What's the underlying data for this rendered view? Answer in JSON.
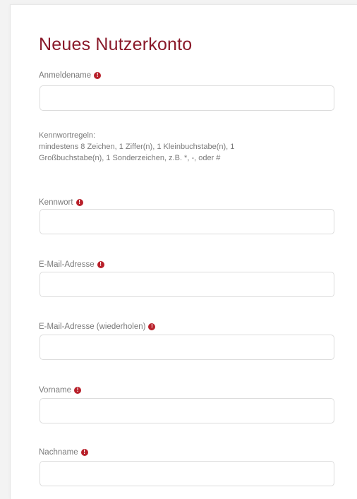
{
  "form": {
    "title": "Neues Nutzerkonto",
    "required_icon": "exclamation-circle-icon",
    "accent_color": "#8a1a2a",
    "required_color": "#b8202a",
    "fields": [
      {
        "label": "Anmeldename",
        "value": "",
        "placeholder": ""
      },
      {
        "label": "Kennwort",
        "value": "",
        "placeholder": ""
      },
      {
        "label": "E-Mail-Adresse",
        "value": "",
        "placeholder": ""
      },
      {
        "label": "E-Mail-Adresse (wiederholen)",
        "value": "",
        "placeholder": ""
      },
      {
        "label": "Vorname",
        "value": "",
        "placeholder": ""
      },
      {
        "label": "Nachname",
        "value": "",
        "placeholder": ""
      }
    ],
    "password_rules": {
      "heading": "Kennwortregeln:",
      "line1": "mindestens 8 Zeichen, 1 Ziffer(n), 1 Kleinbuchstabe(n), 1",
      "line2": "Großbuchstabe(n), 1 Sonderzeichen, z.B. *, -, oder #"
    }
  }
}
